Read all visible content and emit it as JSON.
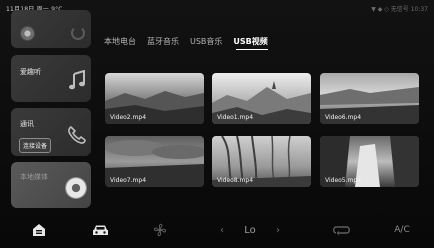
{
  "status": {
    "left_text": "11月18日  周一  9°C",
    "right_text": "▼ ◆ ◇  无信号  10:37"
  },
  "sidebar": {
    "favorites_title": "爱趣听",
    "phone_title": "通讯",
    "connect_label": "连接设备",
    "media_title": "本地媒体"
  },
  "tabs": [
    {
      "label": "本地电台",
      "active": false
    },
    {
      "label": "蓝牙音乐",
      "active": false
    },
    {
      "label": "USB音乐",
      "active": false
    },
    {
      "label": "USB视频",
      "active": true
    }
  ],
  "videos": [
    {
      "name": "Video2.mp4"
    },
    {
      "name": "Video1.mp4"
    },
    {
      "name": "Video6.mp4"
    },
    {
      "name": "Video7.mp4"
    },
    {
      "name": "Video8.mp4"
    },
    {
      "name": "Video5.mp4"
    }
  ],
  "dock": {
    "temp_label": "Lo",
    "ac_label": "A/C",
    "icons": [
      "home-icon",
      "car-icon",
      "fan-icon",
      "chevron-left-icon",
      "chevron-right-icon",
      "recirculation-icon"
    ]
  }
}
